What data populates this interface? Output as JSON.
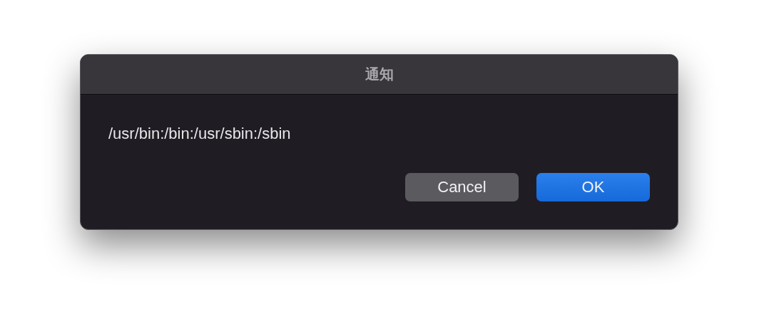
{
  "dialog": {
    "title": "通知",
    "message": "/usr/bin:/bin:/usr/sbin:/sbin",
    "buttons": [
      {
        "label": "Cancel",
        "kind": "secondary"
      },
      {
        "label": "OK",
        "kind": "primary"
      }
    ]
  }
}
